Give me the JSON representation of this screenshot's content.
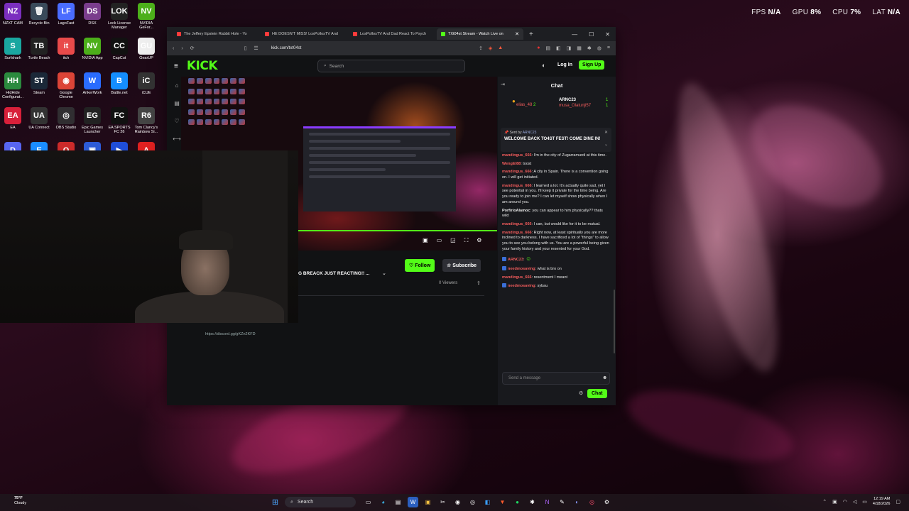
{
  "stats": [
    {
      "key": "FPS",
      "value": "N/A"
    },
    {
      "key": "GPU",
      "value": "8%"
    },
    {
      "key": "CPU",
      "value": "7%"
    },
    {
      "key": "LAT",
      "value": "N/A"
    }
  ],
  "desktop_icons": [
    {
      "label": "NZXT CAM",
      "glyph": "NZ",
      "color": "#7b2fbf"
    },
    {
      "label": "Recycle Bin",
      "glyph": "🗑",
      "color": "#3a4a5a"
    },
    {
      "label": "LagoFast",
      "glyph": "LF",
      "color": "#4a6cff"
    },
    {
      "label": "DSX",
      "glyph": "DS",
      "color": "#7a3d8c"
    },
    {
      "label": "Lock License Manager",
      "glyph": "LOK",
      "color": "#222"
    },
    {
      "label": "NVIDIA GeFor...",
      "glyph": "NV",
      "color": "#4caf1a"
    },
    {
      "label": "Surfshark",
      "glyph": "S",
      "color": "#1aa7a0"
    },
    {
      "label": "Turtle Beach",
      "glyph": "TB",
      "color": "#222"
    },
    {
      "label": "itch",
      "glyph": "it",
      "color": "#e94a4a"
    },
    {
      "label": "NVIDIA App",
      "glyph": "NV",
      "color": "#4caf1a"
    },
    {
      "label": "CapCut",
      "glyph": "CC",
      "color": "#111"
    },
    {
      "label": "GearUP",
      "glyph": "GU",
      "color": "#eee"
    },
    {
      "label": "HidHide Configurat...",
      "glyph": "HH",
      "color": "#2b8a3e"
    },
    {
      "label": "Steam",
      "glyph": "ST",
      "color": "#1b2838"
    },
    {
      "label": "Google Chrome",
      "glyph": "◉",
      "color": "#db4437"
    },
    {
      "label": "AnkerWork",
      "glyph": "W",
      "color": "#2a6cff"
    },
    {
      "label": "Battle.net",
      "glyph": "B",
      "color": "#148eff"
    },
    {
      "label": "iCUE",
      "glyph": "iC",
      "color": "#333"
    },
    {
      "label": "EA",
      "glyph": "EA",
      "color": "#d8203a"
    },
    {
      "label": "UA Connect",
      "glyph": "UA",
      "color": "#333"
    },
    {
      "label": "OBS Studio",
      "glyph": "◎",
      "color": "#302e31"
    },
    {
      "label": "Epic Games Launcher",
      "glyph": "EG",
      "color": "#222"
    },
    {
      "label": "EA SPORTS FC 26",
      "glyph": "FC",
      "color": "#111"
    },
    {
      "label": "Tom Clancy's Rainbow Si...",
      "glyph": "R6",
      "color": "#444"
    },
    {
      "label": "",
      "glyph": "D",
      "color": "#5865f2"
    },
    {
      "label": "",
      "glyph": "E",
      "color": "#1a8cff"
    },
    {
      "label": "",
      "glyph": "O",
      "color": "#cc2a2a"
    },
    {
      "label": "",
      "glyph": "▣",
      "color": "#2d5bd8"
    },
    {
      "label": "",
      "glyph": "▶",
      "color": "#1f4dd8"
    },
    {
      "label": "",
      "glyph": "A",
      "color": "#e02020"
    }
  ],
  "browser": {
    "tabs": [
      {
        "title": "The Jeffery Epstein Rabbit Hole - Yo",
        "active": false
      },
      {
        "title": "HE DOESN'T MISS! LosPollosTV And",
        "active": false
      },
      {
        "title": "LosPollosTV And Dad React To Psych",
        "active": false
      },
      {
        "title": "TXt04st Stream - Watch Live on",
        "active": true
      }
    ],
    "url": "kick.com/txt04st"
  },
  "kick": {
    "logo": "KICK",
    "search_placeholder": "Search",
    "login": "Log In",
    "signup": "Sign Up"
  },
  "stream": {
    "title": "G BREACK JUST REACTING!! ...",
    "follow": "Follow",
    "subscribe": "Subscribe",
    "viewers": "0 Viewers",
    "channel": "txt04st",
    "discord": "https://discord.gg/gKZn2KFD"
  },
  "chat": {
    "title": "Chat",
    "top_users": [
      {
        "name": "elias_48",
        "count": "2",
        "color": "#f25c5c"
      },
      {
        "name": "ARNC23",
        "count": "1",
        "color": "#ffffff"
      },
      {
        "name": "musa_Olatunji57",
        "count": "1",
        "color": "#f25c5c"
      }
    ],
    "pinned": {
      "by_prefix": "Sent by",
      "by_user": "ARNC23",
      "message": "WELCOME BACK TO4ST FEST! COME DINE IN!"
    },
    "messages": [
      {
        "user": "mandingus_666",
        "color": "#f25c5c",
        "text": "I'm in the city of Zugarramurdi at this time.",
        "badge": false
      },
      {
        "user": "WengEl88",
        "color": "#f25c5c",
        "text": "toost",
        "badge": false
      },
      {
        "user": "mandingus_666",
        "color": "#f25c5c",
        "text": "A city in Spain. There is a convention going on. I will get initiated.",
        "badge": false
      },
      {
        "user": "mandingus_666",
        "color": "#f25c5c",
        "text": "I learned a lot. It's actually quite sad, yet I see potential in you. I'll keep it private for the time being. Are you ready to join me? I can let myself show physically when I am around you.",
        "badge": false
      },
      {
        "user": "PorfirioAlamoc",
        "color": "#e8e8e8",
        "text": "you can appear to him physically?? thats wild",
        "badge": false
      },
      {
        "user": "mandingus_666",
        "color": "#f25c5c",
        "text": "I can, but would like for it to be mutual.",
        "badge": false
      },
      {
        "user": "mandingus_666",
        "color": "#f25c5c",
        "text": "Right now, at least spiritually you are more inclined to darkness. I have sacrificed a lot of \"things\" to allow you to see you belong with us. You are a powerful being given your family history and your resented for your God.",
        "badge": false
      },
      {
        "user": "ARNC23",
        "color": "#f25c5c",
        "text": "",
        "badge": true
      },
      {
        "user": "needmosaving",
        "color": "#f25c5c",
        "text": "what is bro on",
        "badge": true
      },
      {
        "user": "mandingus_666",
        "color": "#f25c5c",
        "text": "resentment I meant",
        "badge": false
      },
      {
        "user": "needmosaving",
        "color": "#f25c5c",
        "text": "sybau",
        "badge": true
      }
    ],
    "input_placeholder": "Send a message",
    "send": "Chat"
  },
  "taskbar": {
    "weather_temp": "75°F",
    "weather_desc": "Cloudy",
    "search": "Search",
    "time": "12:19 AM",
    "date": "4/18/2026"
  }
}
